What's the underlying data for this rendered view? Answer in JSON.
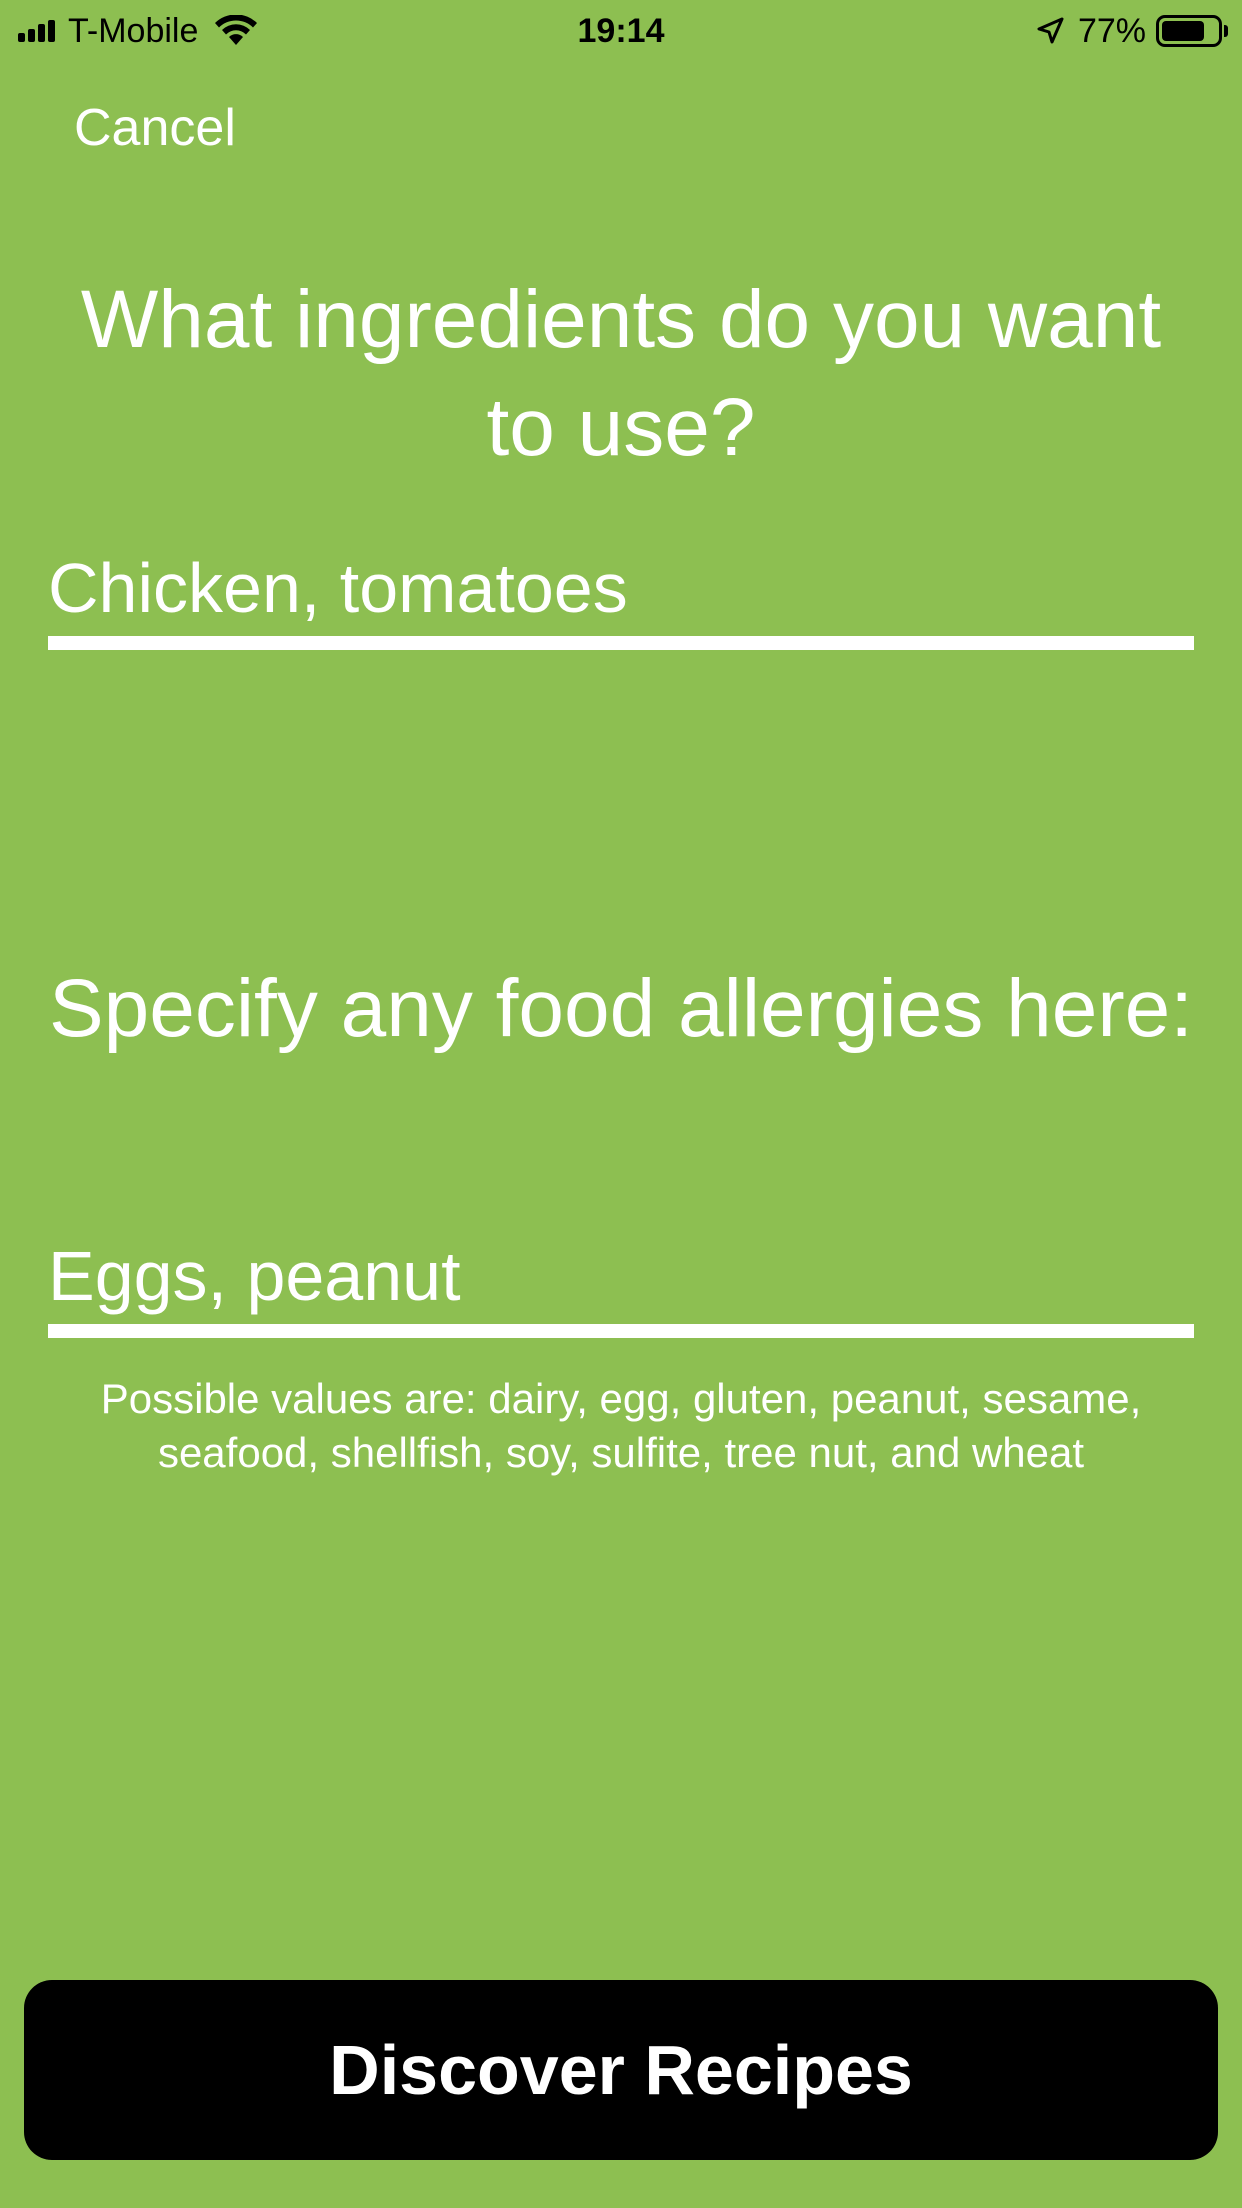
{
  "status_bar": {
    "carrier": "T-Mobile",
    "time": "19:14",
    "battery_percent": "77%",
    "battery_level": 0.77,
    "icons": [
      "signal-icon",
      "wifi-icon",
      "location-arrow-icon",
      "battery-icon"
    ]
  },
  "nav": {
    "cancel_label": "Cancel"
  },
  "ingredients": {
    "question": "What ingredients do you want to use?",
    "value": "Chicken, tomatoes"
  },
  "allergies": {
    "question": "Specify any food allergies here:",
    "value": "Eggs, peanut",
    "hint": "Possible values are: dairy, egg, gluten, peanut, sesame, seafood, shellfish, soy, sulfite, tree nut, and wheat"
  },
  "actions": {
    "discover_label": "Discover Recipes"
  },
  "colors": {
    "background": "#8dbf51",
    "text": "#ffffff",
    "button": "#000000"
  }
}
